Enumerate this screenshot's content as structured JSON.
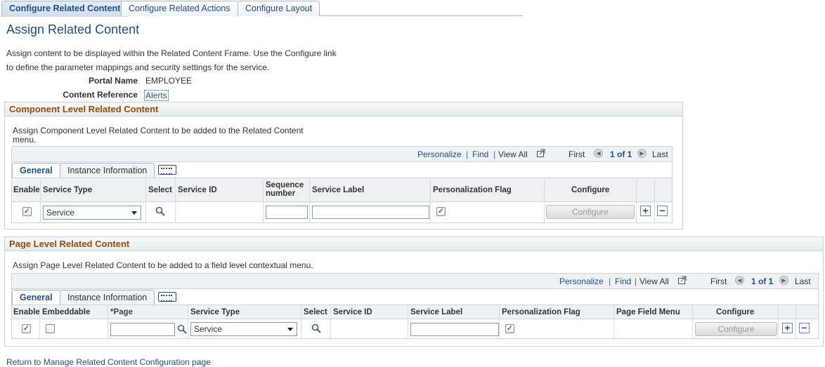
{
  "tabs": [
    {
      "label": "Configure Related Content"
    },
    {
      "label": "Configure Related Actions"
    },
    {
      "label": "Configure Layout"
    }
  ],
  "page_title": "Assign Related Content",
  "description": "Assign content to be displayed within the Related Content Frame. Use the Configure link to define the parameter mappings and security settings for the service.",
  "portal": {
    "label": "Portal Name",
    "value": "EMPLOYEE"
  },
  "content_reference": {
    "label": "Content Reference",
    "value": "Alerts"
  },
  "component_section": {
    "title": "Component Level Related Content",
    "description": "Assign Component Level Related Content to be added to the Related Content menu.",
    "nav": {
      "personalize": "Personalize",
      "find": "Find",
      "view_all": "View All",
      "first": "First",
      "count": "1 of 1",
      "last": "Last"
    },
    "tabs": [
      "General",
      "Instance Information"
    ],
    "columns": {
      "enable": "Enable",
      "service_type": "Service Type",
      "select": "Select",
      "service_id": "Service ID",
      "sequence": "Sequence number",
      "service_label": "Service Label",
      "personalization": "Personalization Flag",
      "configure": "Configure"
    },
    "row": {
      "enable_checked": true,
      "service_type": "Service",
      "personalization_checked": true,
      "configure_label": "Configure"
    }
  },
  "page_section": {
    "title": "Page Level Related Content",
    "description": "Assign Page Level Related Content to be added to a field level contextual menu.",
    "nav": {
      "personalize": "Personalize",
      "find": "Find",
      "view_all": "View All",
      "first": "First",
      "count": "1 of 1",
      "last": "Last"
    },
    "tabs": [
      "General",
      "Instance Information"
    ],
    "columns": {
      "enable": "Enable",
      "embeddable": "Embeddable",
      "page": "*Page",
      "service_type": "Service Type",
      "select": "Select",
      "service_id": "Service ID",
      "service_label": "Service Label",
      "personalization": "Personalization Flag",
      "page_field_menu": "Page Field Menu",
      "configure": "Configure"
    },
    "row": {
      "enable_checked": true,
      "embeddable_checked": false,
      "service_type": "Service",
      "personalization_checked": true,
      "configure_label": "Configure"
    }
  },
  "return_link": "Return to Manage Related Content Configuration page",
  "colors": {
    "link": "#1f4e8c",
    "section_title": "#9a4b00",
    "border": "#c9d3dc",
    "header_bg": "#eef2f6"
  }
}
